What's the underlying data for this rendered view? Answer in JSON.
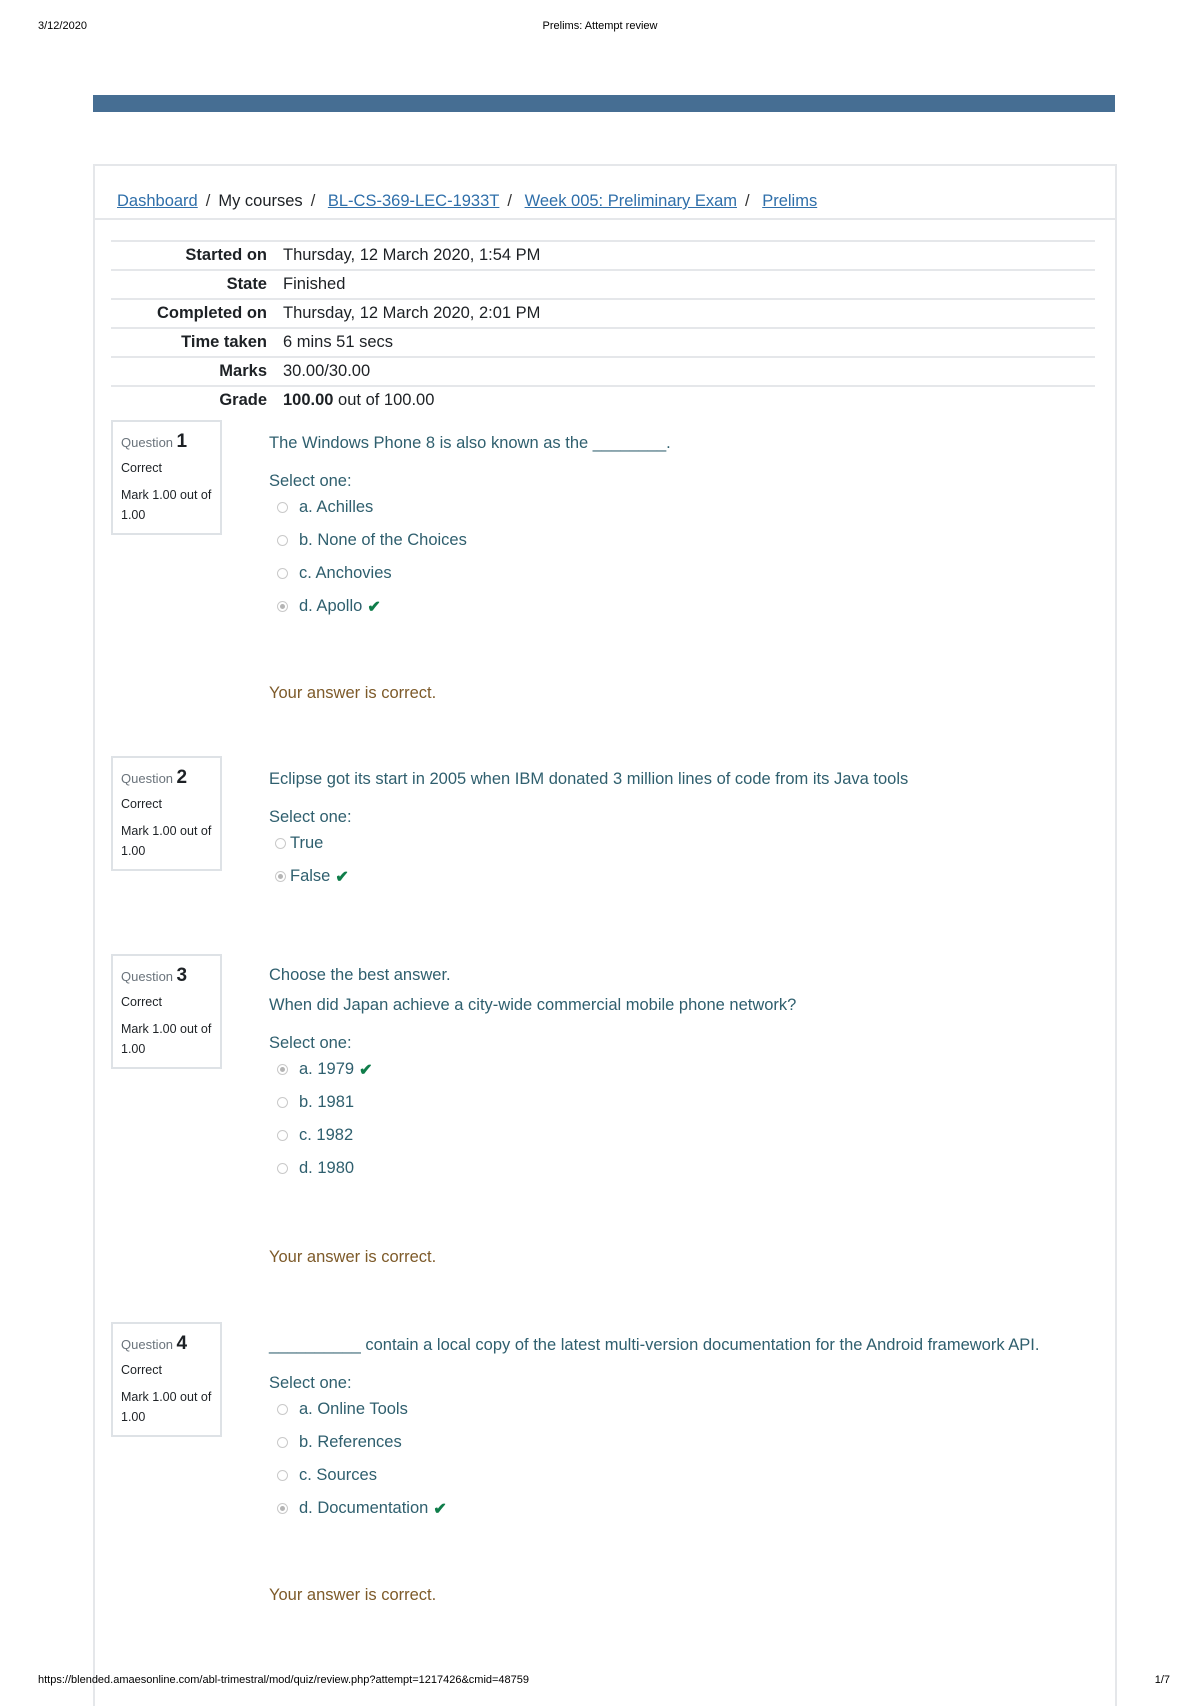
{
  "print": {
    "date": "3/12/2020",
    "title": "Prelims: Attempt review",
    "url": "https://blended.amaesonline.com/abl-trimestral/mod/quiz/review.php?attempt=1217426&cmid=48759",
    "page": "1/7"
  },
  "colors": {
    "top_bar": "#466e93",
    "link": "#2f6faa",
    "question_text": "#2f5f6e",
    "feedback": "#7d5a29",
    "correct_check": "#0f7d4a"
  },
  "breadcrumb": [
    {
      "label": "Dashboard",
      "link": true
    },
    {
      "label": "My courses",
      "link": false
    },
    {
      "label": "BL-CS-369-LEC-1933T",
      "link": true
    },
    {
      "label": "Week 005: Preliminary Exam",
      "link": true
    },
    {
      "label": "Prelims",
      "link": true
    }
  ],
  "summary": [
    {
      "label": "Started on",
      "value": "Thursday, 12 March 2020, 1:54 PM"
    },
    {
      "label": "State",
      "value": "Finished"
    },
    {
      "label": "Completed on",
      "value": "Thursday, 12 March 2020, 2:01 PM"
    },
    {
      "label": "Time taken",
      "value": "6 mins 51 secs"
    },
    {
      "label": "Marks",
      "value": "30.00/30.00"
    },
    {
      "label": "Grade",
      "value_bold": "100.00",
      "value": " out of 100.00"
    }
  ],
  "questions": [
    {
      "label": "Question",
      "number": "1",
      "state": "Correct",
      "grade": "Mark 1.00 out of 1.00",
      "text": [
        "The Windows Phone 8 is also known as the ________."
      ],
      "prompt": "Select one:",
      "options": [
        {
          "label": "a. Achilles",
          "checked": false,
          "correct": false
        },
        {
          "label": "b. None of the Choices",
          "checked": false,
          "correct": false
        },
        {
          "label": "c. Anchovies",
          "checked": false,
          "correct": false
        },
        {
          "label": "d. Apollo",
          "checked": true,
          "correct": true
        }
      ],
      "feedback": "Your answer is correct."
    },
    {
      "label": "Question",
      "number": "2",
      "state": "Correct",
      "grade": "Mark 1.00 out of 1.00",
      "text": [
        "Eclipse got its start in 2005 when IBM donated 3 million lines of code from its Java tools"
      ],
      "prompt": "Select one:",
      "options": [
        {
          "label": "True",
          "checked": false,
          "correct": false
        },
        {
          "label": "False",
          "checked": true,
          "correct": true
        }
      ],
      "feedback": ""
    },
    {
      "label": "Question",
      "number": "3",
      "state": "Correct",
      "grade": "Mark 1.00 out of 1.00",
      "text": [
        "Choose the best answer.",
        "When did Japan achieve a city-wide commercial mobile phone network?"
      ],
      "prompt": "Select one:",
      "options": [
        {
          "label": "a. 1979",
          "checked": true,
          "correct": true
        },
        {
          "label": "b. 1981",
          "checked": false,
          "correct": false
        },
        {
          "label": "c. 1982",
          "checked": false,
          "correct": false
        },
        {
          "label": "d. 1980",
          "checked": false,
          "correct": false
        }
      ],
      "feedback": "Your answer is correct."
    },
    {
      "label": "Question",
      "number": "4",
      "state": "Correct",
      "grade": "Mark 1.00 out of 1.00",
      "text": [
        "__________ contain a local copy of the latest multi-version documentation for the Android framework API."
      ],
      "prompt": "Select one:",
      "options": [
        {
          "label": "a. Online Tools",
          "checked": false,
          "correct": false
        },
        {
          "label": "b. References",
          "checked": false,
          "correct": false
        },
        {
          "label": "c. Sources",
          "checked": false,
          "correct": false
        },
        {
          "label": "d. Documentation",
          "checked": true,
          "correct": true
        }
      ],
      "feedback": "Your answer is correct."
    }
  ]
}
